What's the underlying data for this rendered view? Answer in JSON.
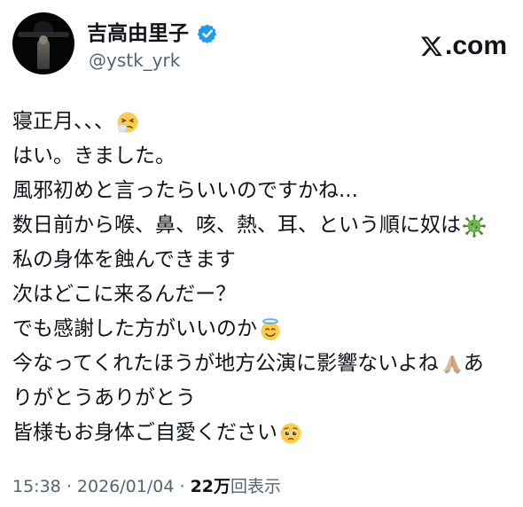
{
  "header": {
    "display_name": "吉高由里子",
    "handle": "@ystk_yrk",
    "site_label": ".com",
    "verified_badge": "verified-icon",
    "colors": {
      "verified": "#1d9bf0",
      "secondary_text": "#536471",
      "primary_text": "#0f1419"
    }
  },
  "tweet": {
    "lines": [
      {
        "text": "寝正月、、、",
        "emoji": "sneezing-face-icon"
      },
      {
        "text": "はい。きました。"
      },
      {
        "text": "風邪初めと言ったらいいのですかね..."
      },
      {
        "text": "数日前から喉、鼻、咳、熱、耳、という順に奴は",
        "emoji": "microbe-icon"
      },
      {
        "text": "私の身体を蝕んできます"
      },
      {
        "text": "次はどこに来るんだー？"
      },
      {
        "text": "でも感謝した方がいいのか",
        "emoji": "smiling-face-with-halo-icon"
      },
      {
        "text": "今なってくれたほうが地方公演に影響ないよね",
        "emoji": "folded-hands-icon",
        "after": "あ"
      },
      {
        "text": "りがとうありがとう"
      },
      {
        "text": "皆様もお身体ご自愛ください",
        "emoji": "pleading-face-icon"
      }
    ]
  },
  "meta": {
    "time": "15:38",
    "separator": "·",
    "date": "2026/01/04",
    "views_count": "22万",
    "views_label": "回表示"
  }
}
